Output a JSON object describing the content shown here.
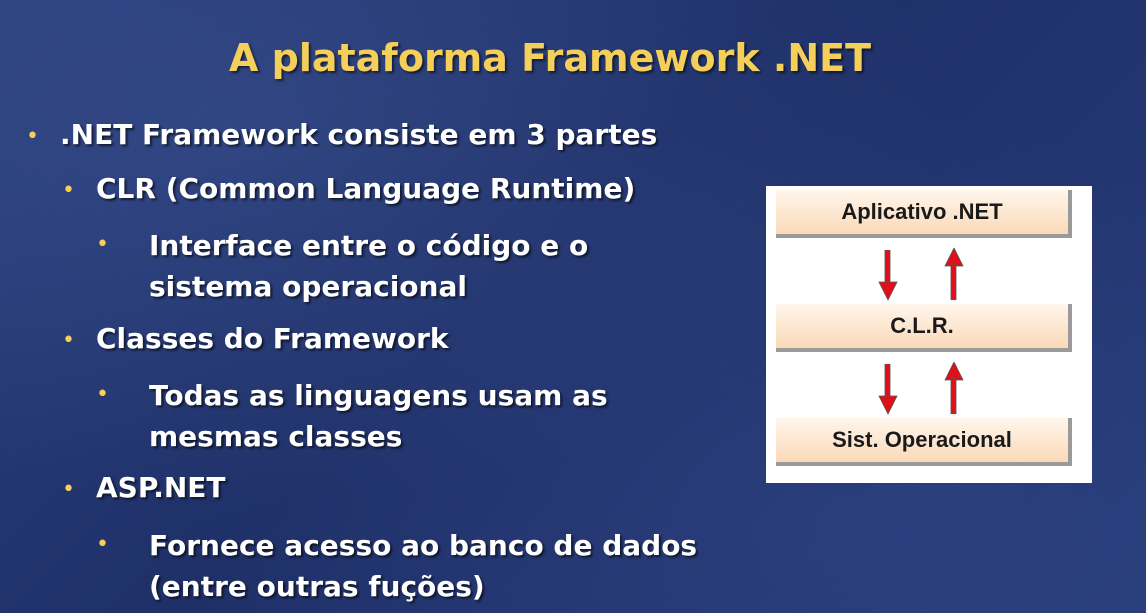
{
  "title": "A plataforma Framework .NET",
  "bullets": {
    "b1": ".NET Framework consiste em 3 partes",
    "b1_1": "CLR (Common Language Runtime)",
    "b1_1_1_line1": "Interface entre o código e o",
    "b1_1_1_line2": "sistema operacional",
    "b1_2": "Classes do Framework",
    "b1_2_1_line1": "Todas as linguagens usam as",
    "b1_2_1_line2": "mesmas classes",
    "b1_3": "ASP.NET",
    "b1_3_1_line1": "Fornece acesso ao banco de dados",
    "b1_3_1_line2": "(entre outras fuções)"
  },
  "bullet_glyph": "•",
  "diagram": {
    "top_box": "Aplicativo .NET",
    "middle_box": "C.L.R.",
    "bottom_box": "Sist. Operacional",
    "arrow_color": "#e0101a"
  },
  "colors": {
    "title": "#f4cf5a",
    "bullet": "#f4cf5a",
    "text": "#ffffff",
    "background": "#233670"
  }
}
